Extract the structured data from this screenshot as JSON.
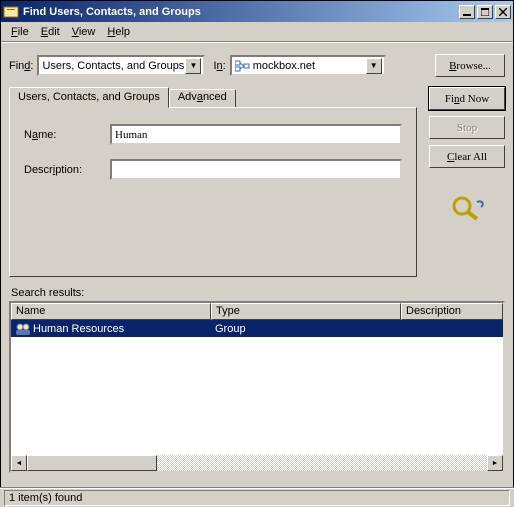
{
  "window": {
    "title": "Find Users, Contacts, and Groups"
  },
  "menu": {
    "file": "File",
    "edit": "Edit",
    "view": "View",
    "help": "Help"
  },
  "findrow": {
    "find_label": "Find:",
    "find_value": "Users, Contacts, and Groups",
    "in_label": "In:",
    "in_value": "mockbox.net",
    "browse_label": "Browse..."
  },
  "tabs": {
    "main": "Users, Contacts, and Groups",
    "advanced": "Advanced"
  },
  "form": {
    "name_label": "Name:",
    "name_value": "Human",
    "desc_label": "Description:",
    "desc_value": ""
  },
  "buttons": {
    "find_now": "Find Now",
    "stop": "Stop",
    "clear_all": "Clear All"
  },
  "results": {
    "label": "Search results:",
    "columns": {
      "name": "Name",
      "type": "Type",
      "desc": "Description"
    },
    "rows": [
      {
        "name": "Human Resources",
        "type": "Group",
        "desc": ""
      }
    ]
  },
  "status": {
    "text": "1 item(s) found"
  }
}
